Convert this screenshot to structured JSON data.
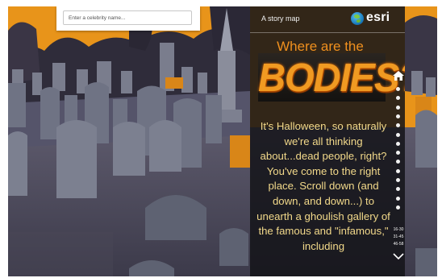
{
  "search": {
    "placeholder": "Enter a celebrity name..."
  },
  "panel": {
    "story_label": "A story map",
    "logo_text": "esri",
    "title_line1": "Where are the",
    "title_line2": "BODIES?",
    "body": "It's Halloween, so naturally we're all thinking about...dead people, right? You've come to the right place. Scroll down (and down, and down...) to unearth a ghoulish gallery of the famous and \"infamous,\" including"
  },
  "nav": {
    "home_icon": "home-icon",
    "dot_count": 14,
    "ranges": [
      "16-30",
      "31-45",
      "46-58"
    ],
    "more_icon": "chevron-down-icon"
  },
  "colors": {
    "title_orange": "#f0901e",
    "body_text": "#f2d98a",
    "panel_bg": "#141418",
    "sky_orange": "#e8941a",
    "stone_blue": "#6f7384",
    "grass_purple": "#4e4c60"
  }
}
